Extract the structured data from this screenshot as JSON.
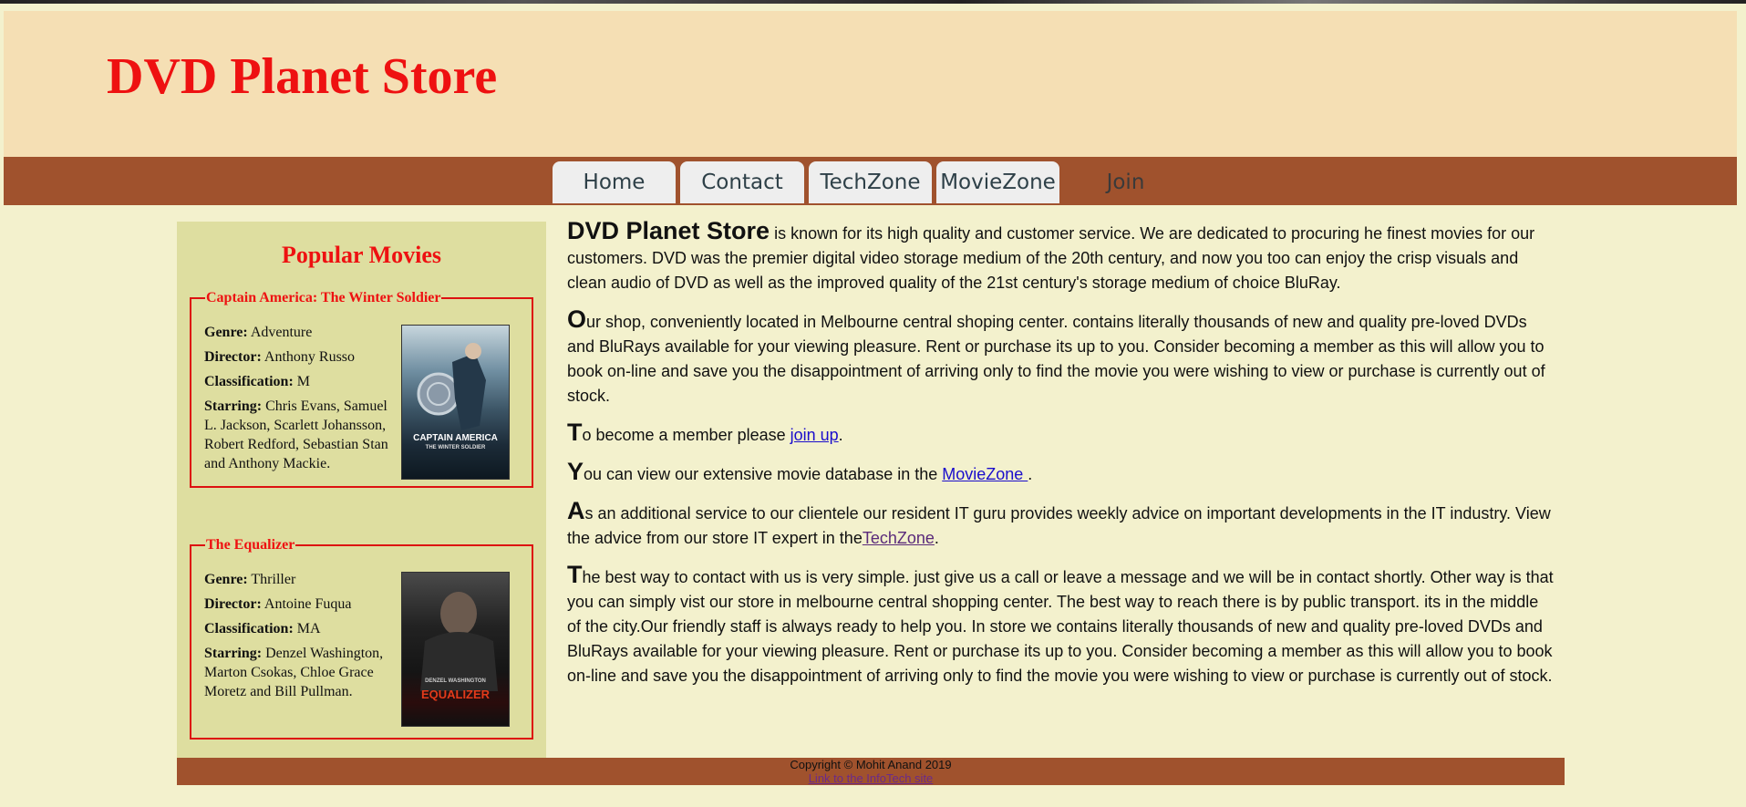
{
  "site_title": "DVD Planet Store",
  "nav": {
    "items": [
      {
        "label": "Home"
      },
      {
        "label": "Contact"
      },
      {
        "label": "TechZone"
      },
      {
        "label": "MovieZone"
      },
      {
        "label": "Join"
      }
    ]
  },
  "sidebar": {
    "heading": "Popular Movies",
    "labels": {
      "genre": "Genre:",
      "director": "Director:",
      "classification": "Classification:",
      "starring": "Starring:"
    },
    "movies": [
      {
        "title": "Captain America: The Winter Soldier",
        "genre": "Adventure",
        "director": "Anthony Russo",
        "classification": "M",
        "starring": "Chris Evans, Samuel L. Jackson, Scarlett Johansson, Robert Redford, Sebastian Stan and Anthony Mackie.",
        "poster_caption": "CAPTAIN AMERICA",
        "poster_subcaption": "THE WINTER SOLDIER"
      },
      {
        "title": "The Equalizer",
        "genre": "Thriller",
        "director": "Antoine Fuqua",
        "classification": "MA",
        "starring": "Denzel Washington, Marton Csokas, Chloe Grace Moretz and Bill Pullman.",
        "poster_caption": "EQUALIZER",
        "poster_subcaption": "DENZEL WASHINGTON"
      }
    ]
  },
  "main": {
    "p1_lead": "DVD Planet Store",
    "p1_text": " is known for its high quality and customer service. We are dedicated to procuring he finest movies for our customers. DVD was the premier digital video storage medium of the 20th century, and now you too can enjoy the crisp visuals and clean audio of DVD as well as the improved quality of the 21st century's storage medium of choice BluRay.",
    "p2_cap": "O",
    "p2_text": "ur shop, conveniently located in Melbourne central shoping center. contains literally thousands of new and quality pre-loved DVDs and BluRays available for your viewing pleasure. Rent or purchase its up to you. Consider becoming a member as this will allow you to book on-line and save you the disappointment of arriving only to find the movie you were wishing to view or purchase is currently out of stock.",
    "p3_cap": "T",
    "p3_text": "o become a member please ",
    "p3_link": "join up",
    "p3_end": ".",
    "p4_cap": "Y",
    "p4_text": "ou can view our extensive movie database in the ",
    "p4_link": "MovieZone ",
    "p4_end": ".",
    "p5_cap": "A",
    "p5_text": "s an additional service to our clientele our resident IT guru provides weekly advice on important developments in the IT industry. View the advice from our store IT expert in the",
    "p5_link": "TechZone",
    "p5_end": ".",
    "p6_cap": "T",
    "p6_text": "he best way to contact with us is very simple. just give us a call or leave a message and we will be in contact shortly. Other way is that you can simply vist our store in melbourne central shopping center. The best way to reach there is by public transport. its in the middle of the city.Our friendly staff is always ready to help you. In store we contains literally thousands of new and quality pre-loved DVDs and BluRays available for your viewing pleasure. Rent or purchase its up to you. Consider becoming a member as this will allow you to book on-line and save you the disappointment of arriving only to find the movie you were wishing to view or purchase is currently out of stock."
  },
  "footer": {
    "copyright": "Copyright © Mohit Anand 2019",
    "link": "Link to the InfoTech site"
  },
  "colors": {
    "header_bg": "#f5dfb4",
    "nav_bg": "#a0522d",
    "page_bg": "#f3f1cd",
    "sidebar_bg": "#dedea0",
    "accent_red": "#ee1111"
  }
}
